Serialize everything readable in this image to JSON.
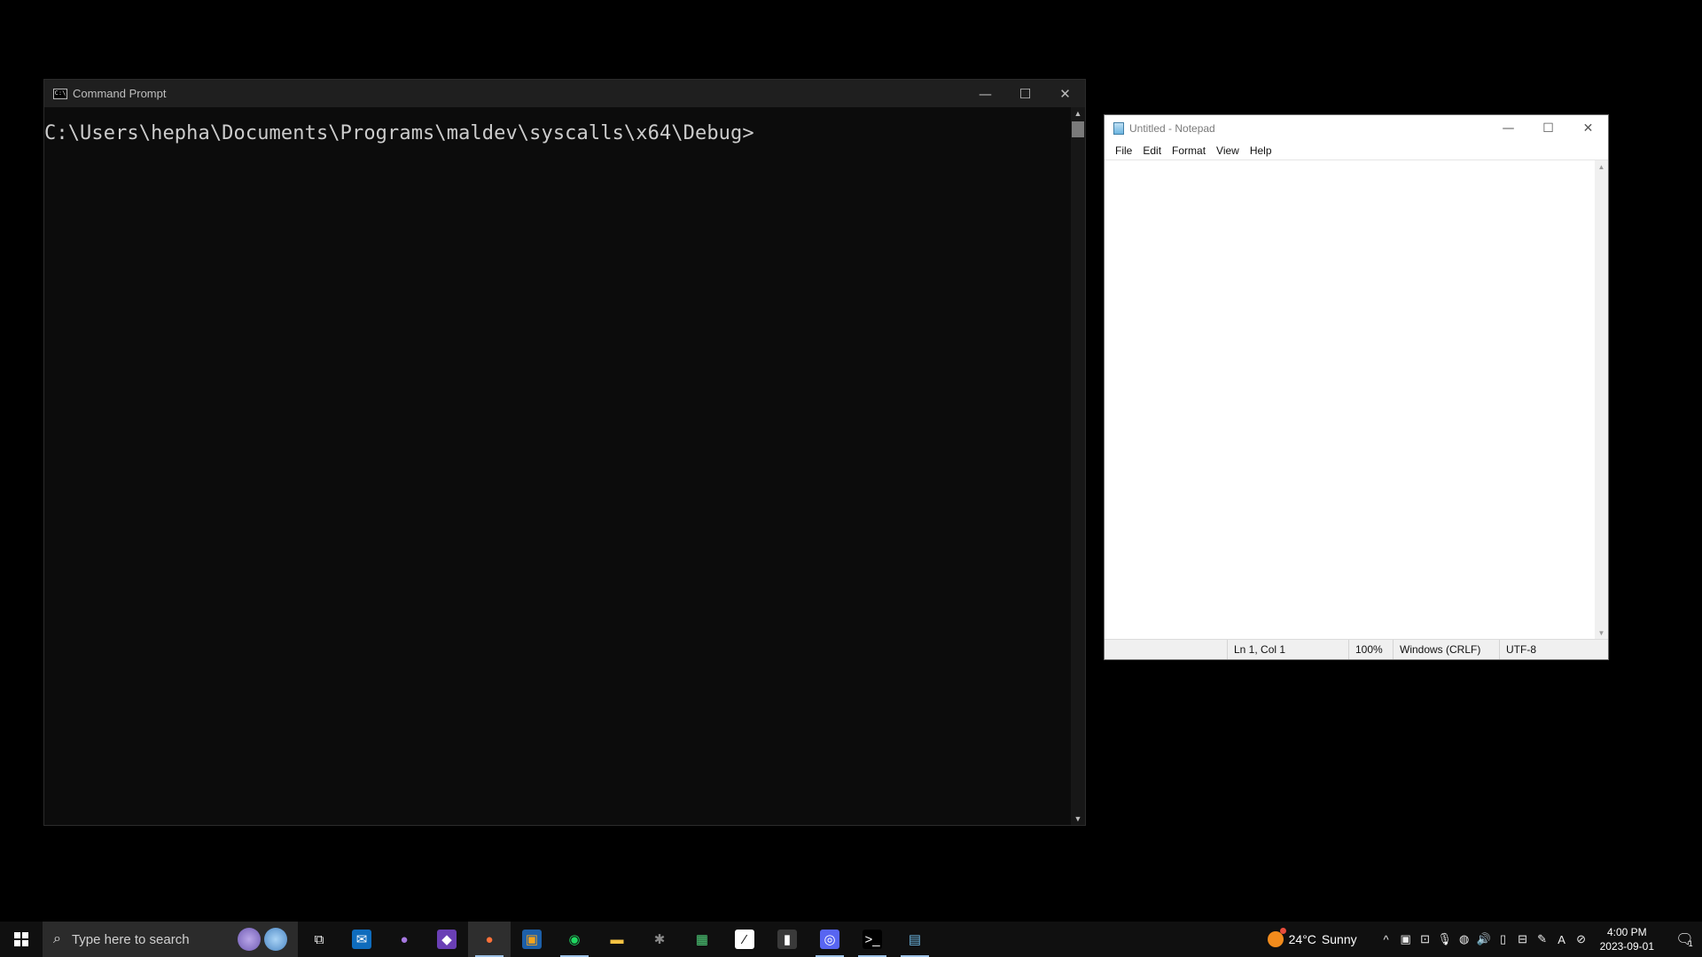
{
  "cmd": {
    "title": "Command Prompt",
    "icon_text": "C:\\",
    "prompt": "C:\\Users\\hepha\\Documents\\Programs\\maldev\\syscalls\\x64\\Debug>"
  },
  "notepad": {
    "title": "Untitled - Notepad",
    "menu": [
      "File",
      "Edit",
      "Format",
      "View",
      "Help"
    ],
    "status": {
      "position": "Ln 1, Col 1",
      "zoom": "100%",
      "line_ending": "Windows (CRLF)",
      "encoding": "UTF-8"
    }
  },
  "window_buttons": {
    "minimize": "—",
    "maximize": "☐",
    "close": "✕"
  },
  "taskbar": {
    "search_placeholder": "Type here to search",
    "apps": [
      {
        "name": "task-view-icon",
        "glyph": "⧉",
        "color": "#ffffff",
        "bg": "transparent",
        "running": false,
        "active": false
      },
      {
        "name": "mail-icon",
        "glyph": "✉",
        "color": "#ffffff",
        "bg": "#0f6cbd",
        "running": false,
        "active": false
      },
      {
        "name": "tor-browser-icon",
        "glyph": "●",
        "color": "#a678e0",
        "bg": "transparent",
        "running": false,
        "active": false
      },
      {
        "name": "visual-studio-icon",
        "glyph": "◆",
        "color": "#ffffff",
        "bg": "#6a3fb5",
        "running": false,
        "active": false
      },
      {
        "name": "firefox-icon",
        "glyph": "●",
        "color": "#ff7139",
        "bg": "transparent",
        "running": true,
        "active": true
      },
      {
        "name": "vmware-icon",
        "glyph": "▣",
        "color": "#f4a31b",
        "bg": "#1d5fa8",
        "running": false,
        "active": false
      },
      {
        "name": "spotify-icon",
        "glyph": "◉",
        "color": "#1ed760",
        "bg": "transparent",
        "running": true,
        "active": false
      },
      {
        "name": "file-explorer-icon",
        "glyph": "▬",
        "color": "#f6c343",
        "bg": "transparent",
        "running": false,
        "active": false
      },
      {
        "name": "bug-icon",
        "glyph": "✱",
        "color": "#888888",
        "bg": "transparent",
        "running": false,
        "active": false
      },
      {
        "name": "chip-icon",
        "glyph": "▦",
        "color": "#4fd17a",
        "bg": "transparent",
        "running": false,
        "active": false
      },
      {
        "name": "notes-icon",
        "glyph": "⁄",
        "color": "#000000",
        "bg": "#ffffff",
        "running": false,
        "active": false
      },
      {
        "name": "twitch-icon",
        "glyph": "▮",
        "color": "#ffffff",
        "bg": "#3a3a3a",
        "running": false,
        "active": false
      },
      {
        "name": "discord-icon",
        "glyph": "◎",
        "color": "#ffffff",
        "bg": "#5865f2",
        "running": true,
        "active": false
      },
      {
        "name": "terminal-icon",
        "glyph": ">_",
        "color": "#ffffff",
        "bg": "#000000",
        "running": true,
        "active": false
      },
      {
        "name": "notepad-icon",
        "glyph": "▤",
        "color": "#6cb5e0",
        "bg": "transparent",
        "running": true,
        "active": false
      }
    ],
    "weather": {
      "temp": "24°C",
      "condition": "Sunny"
    },
    "tray_icons": [
      {
        "name": "chevron-up-icon",
        "glyph": "^"
      },
      {
        "name": "onenote-icon",
        "glyph": "▣"
      },
      {
        "name": "display-icon",
        "glyph": "⊡"
      },
      {
        "name": "microphone-icon",
        "glyph": "🎙"
      },
      {
        "name": "discord-tray-icon",
        "glyph": "◍"
      },
      {
        "name": "volume-icon",
        "glyph": "🔊"
      },
      {
        "name": "battery-icon",
        "glyph": "▯"
      },
      {
        "name": "network-icon",
        "glyph": "⊟"
      },
      {
        "name": "pen-icon",
        "glyph": "✎"
      },
      {
        "name": "language-icon",
        "glyph": "A"
      },
      {
        "name": "input-icon",
        "glyph": "⊘"
      }
    ],
    "time": "4:00 PM",
    "date": "2023-09-01",
    "notification_count": "1"
  }
}
